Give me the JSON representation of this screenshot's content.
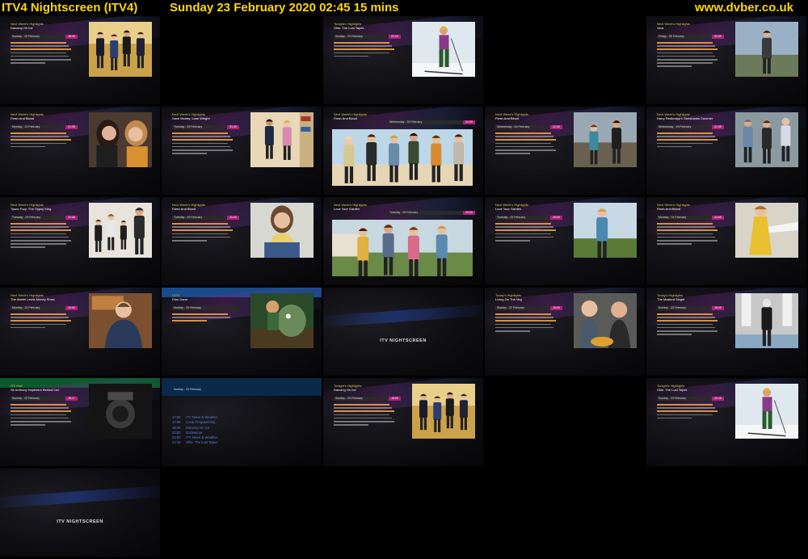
{
  "header": {
    "channel": "ITV4 Nightscreen (ITV4)",
    "datetime": "Sunday 23 February 2020  02:45  15 mins",
    "site": "www.dvber.co.uk"
  },
  "tiles": [
    {
      "id": "r0c0",
      "type": "promo",
      "hl": "Next Week's Highlights",
      "name": "Dancing On Ice",
      "day": "Sunday - 23 February",
      "time": "18:00",
      "pic": "dancers",
      "lines": 7
    },
    {
      "id": "r0c1",
      "type": "blank"
    },
    {
      "id": "r0c2",
      "type": "promo",
      "hl": "Tonight's Highlights",
      "name": "Ollie: The Lost Tapes",
      "day": "Sunday - 23 February",
      "time": "22:10",
      "pic": "skier",
      "lines": 5
    },
    {
      "id": "r0c3",
      "type": "blank"
    },
    {
      "id": "r0c4",
      "type": "promo",
      "hl": "Next Week's Highlights",
      "name": "Vera",
      "day": "Friday - 28 February",
      "time": "21:00",
      "pic": "vera",
      "lines": 8
    },
    {
      "id": "r1c0",
      "type": "promo",
      "hl": "Next Week's Highlights",
      "name": "Flesh And Blood",
      "day": "Monday - 24 February",
      "time": "21:00",
      "pic": "two_women",
      "lines": 5
    },
    {
      "id": "r1c1",
      "type": "promo",
      "hl": "Next Week's Highlights",
      "name": "Save Money: Lose Weight",
      "day": "Tuesday - 25 February",
      "time": "21:00",
      "pic": "couple_shop",
      "lines": 7
    },
    {
      "id": "r1c2",
      "type": "wide",
      "hl": "Next Week's Highlights",
      "name": "Flesh And Blood",
      "day": "Wednesday - 26 February",
      "time": "21:00",
      "pic": "family_beach"
    },
    {
      "id": "r1c3",
      "type": "promo",
      "hl": "Next Week's Highlights",
      "name": "Flesh And Blood",
      "day": "Wednesday - 26 February",
      "time": "21:00",
      "pic": "beach_pair",
      "lines": 7
    },
    {
      "id": "r2c0",
      "type": "promo",
      "hl": "Next Week's Highlights",
      "name": "Harry Redknapp's Sandbanks Summer",
      "day": "Wednesday - 26 February",
      "time": "21:00",
      "pic": "three_men",
      "lines": 5
    },
    {
      "id": "r2c1",
      "type": "promo",
      "hl": "Next Week's Highlights",
      "name": "Tyson Fury: The Gypsy King",
      "day": "Tuesday - 25 February",
      "time": "21:00",
      "pic": "family_group",
      "lines": 8
    },
    {
      "id": "r2c2",
      "type": "promo",
      "hl": "Next Week's Highlights",
      "name": "Flesh And Blood",
      "day": "Tuesday - 25 February",
      "time": "21:00",
      "pic": "woman_sitting",
      "lines": 6
    },
    {
      "id": "r2c3",
      "type": "wide",
      "hl": "Next Week's Highlights",
      "name": "Love Your Garden",
      "day": "Tuesday - 25 February",
      "time": "20:00",
      "pic": "garden_group"
    },
    {
      "id": "r2c4",
      "type": "promo",
      "hl": "Next Week's Highlights",
      "name": "Love Your Garden",
      "day": "Tuesday - 25 February",
      "time": "20:00",
      "pic": "gardener",
      "lines": 6
    },
    {
      "id": "r3c0",
      "type": "promo",
      "hl": "Next Week's Highlights",
      "name": "Flesh And Blood",
      "day": "Monday - 24 February",
      "time": "21:00",
      "pic": "yellow_dress",
      "lines": 7
    },
    {
      "id": "r3c1",
      "type": "promo",
      "hl": "Next Week's Highlights",
      "name": "The Martin Lewis Money Show",
      "day": "Monday - 24 February",
      "time": "20:00",
      "pic": "presenter",
      "lines": 5
    },
    {
      "id": "r3c2",
      "type": "citv",
      "hl": "CITV",
      "name": "Dino Dana",
      "day": "Sunday - 23 February",
      "time": "",
      "pic": "dino_cartoon",
      "lines": 3
    },
    {
      "id": "r3c3",
      "type": "nightscreen",
      "label": "ITV NIGHTSCREEN"
    },
    {
      "id": "r3c4",
      "type": "promo",
      "hl": "Today's Highlights",
      "name": "Living On The Veg",
      "day": "Sunday - 23 February",
      "time": "10:00",
      "pic": "two_chefs",
      "lines": 6
    },
    {
      "id": "r4c0",
      "type": "promo",
      "hl": "Today's Highlights",
      "name": "The Masked Singer",
      "day": "Sunday - 23 February",
      "time": "18:00",
      "pic": "performer",
      "lines": 7
    },
    {
      "id": "r4c1",
      "type": "itvhub",
      "hl": "ITV Hub",
      "name": "Sir Anthony Hopkins's Behind List",
      "day": "Sunday - 23 February",
      "time": "19:17",
      "pic": "engine",
      "lines": 7
    },
    {
      "id": "r4c2",
      "type": "schedule",
      "day": "Sunday - 23 February",
      "rows": [
        {
          "time": "17:00",
          "title": "ITV News & Weather"
        },
        {
          "time": "17:05",
          "title": "Local Programming"
        },
        {
          "time": "18:00",
          "title": "Dancing On Ice"
        },
        {
          "time": "20:00",
          "title": "Endeavour"
        },
        {
          "time": "22:00",
          "title": "ITV News & Weather"
        },
        {
          "time": "22:10",
          "title": "Ollie: The Lost Tapes"
        }
      ]
    },
    {
      "id": "r4c3",
      "type": "promo",
      "hl": "Tonight's Highlights",
      "name": "Dancing On Ice",
      "day": "Sunday - 23 February",
      "time": "18:00",
      "pic": "dancers",
      "lines": 7
    },
    {
      "id": "r4c4",
      "type": "blank"
    },
    {
      "id": "r5c0",
      "type": "promo",
      "hl": "Tonight's Highlights",
      "name": "Ollie: The Lost Tapes",
      "day": "Sunday - 23 February",
      "time": "22:10",
      "pic": "skier",
      "lines": 5
    },
    {
      "id": "r5c1",
      "type": "nightscreen",
      "label": "ITV NIGHTSCREEN"
    },
    {
      "id": "r5c2",
      "type": "blank"
    },
    {
      "id": "r5c3",
      "type": "blank"
    },
    {
      "id": "r5c4",
      "type": "blank"
    }
  ]
}
